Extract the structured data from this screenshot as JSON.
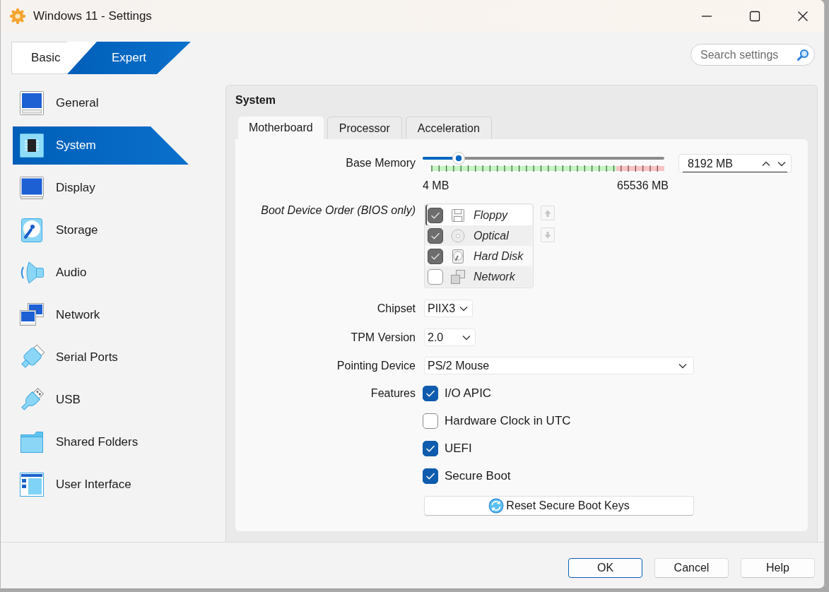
{
  "window": {
    "title": "Windows 11 - Settings"
  },
  "mode_tabs": [
    {
      "label": "Basic",
      "selected": false
    },
    {
      "label": "Expert",
      "selected": true
    }
  ],
  "search": {
    "placeholder": "Search settings"
  },
  "sidebar": {
    "items": [
      {
        "label": "General",
        "kind": "general",
        "selected": false
      },
      {
        "label": "System",
        "kind": "system",
        "selected": true
      },
      {
        "label": "Display",
        "kind": "display",
        "selected": false
      },
      {
        "label": "Storage",
        "kind": "storage",
        "selected": false
      },
      {
        "label": "Audio",
        "kind": "audio",
        "selected": false
      },
      {
        "label": "Network",
        "kind": "network",
        "selected": false
      },
      {
        "label": "Serial Ports",
        "kind": "serial",
        "selected": false
      },
      {
        "label": "USB",
        "kind": "usb",
        "selected": false
      },
      {
        "label": "Shared Folders",
        "kind": "folders",
        "selected": false
      },
      {
        "label": "User Interface",
        "kind": "ui",
        "selected": false
      }
    ]
  },
  "page": {
    "title": "System",
    "tabs": [
      {
        "label": "Motherboard",
        "selected": true
      },
      {
        "label": "Processor",
        "selected": false
      },
      {
        "label": "Acceleration",
        "selected": false
      }
    ],
    "base_memory": {
      "label": "Base Memory",
      "level": 0.15,
      "min_label": "4 MB",
      "max_label": "65536 MB",
      "value": "8192 MB"
    },
    "boot_order": {
      "label": "Boot Device Order (BIOS only)",
      "disabled": true,
      "items": [
        {
          "label": "Floppy",
          "kind": "floppy",
          "checked": true,
          "selected": true
        },
        {
          "label": "Optical",
          "kind": "optical",
          "checked": true,
          "selected": false
        },
        {
          "label": "Hard Disk",
          "kind": "hard_disk",
          "checked": true,
          "selected": false
        },
        {
          "label": "Network",
          "kind": "network",
          "checked": false,
          "selected": false
        }
      ]
    },
    "chipset": {
      "label": "Chipset",
      "value": "PIIX3"
    },
    "tpm_version": {
      "label": "TPM Version",
      "value": "2.0"
    },
    "pointing_device": {
      "label": "Pointing Device",
      "value": "PS/2 Mouse"
    },
    "features": {
      "label": "Features",
      "options": [
        {
          "label": "I/O APIC",
          "checked": true
        },
        {
          "label": "Hardware Clock in UTC",
          "checked": false
        },
        {
          "label": "UEFI",
          "checked": true
        },
        {
          "label": "Secure Boot",
          "checked": true
        }
      ]
    },
    "reset_button": {
      "label": "Reset Secure Boot Keys"
    }
  },
  "buttons": [
    {
      "label": "OK",
      "default": true
    },
    {
      "label": "Cancel",
      "default": false
    },
    {
      "label": "Help",
      "default": false
    }
  ]
}
